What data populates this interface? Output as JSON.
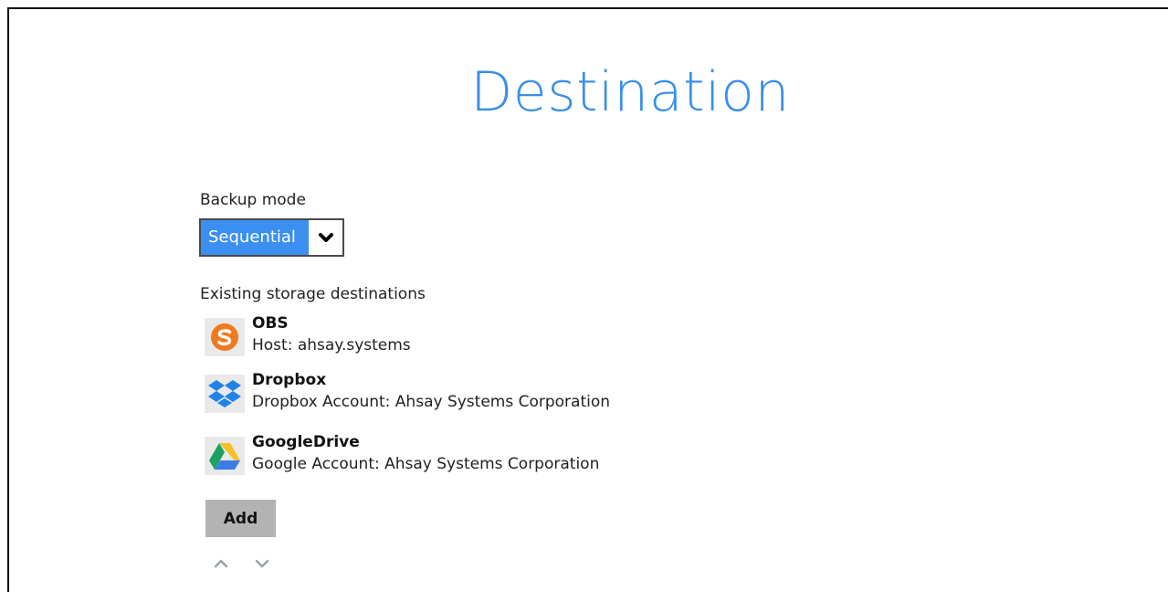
{
  "page": {
    "title": "Destination"
  },
  "backup_mode": {
    "label": "Backup mode",
    "selected": "Sequential"
  },
  "destinations": {
    "label": "Existing storage destinations",
    "items": [
      {
        "name": "OBS",
        "detail": "Host: ahsay.systems",
        "icon": "obs-icon"
      },
      {
        "name": "Dropbox",
        "detail": "Dropbox Account: Ahsay Systems Corporation",
        "icon": "dropbox-icon"
      },
      {
        "name": "GoogleDrive",
        "detail": "Google Account: Ahsay Systems Corporation",
        "icon": "google-drive-icon"
      }
    ]
  },
  "actions": {
    "add_label": "Add",
    "move_up_icon": "chevron-up-icon",
    "move_down_icon": "chevron-down-icon"
  },
  "colors": {
    "title": "#3a8fe8",
    "select_bg": "#3b8ff0",
    "button_bg": "#b3b3b3",
    "obs_orange": "#f07a1e"
  }
}
